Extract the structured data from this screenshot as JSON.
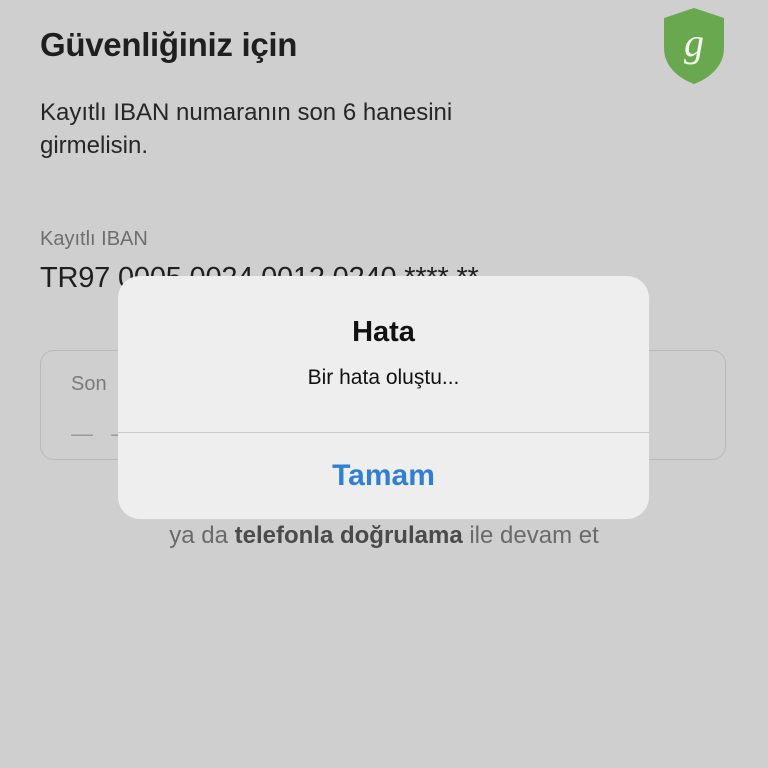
{
  "header": {
    "title": "Güvenliğiniz için",
    "logo_letter": "g",
    "logo_icon": "shield-logo-icon",
    "logo_color": "#6aa84f"
  },
  "content": {
    "description": "Kayıtlı IBAN numaranın son 6 hanesini girmelisin.",
    "iban_label": "Kayıtlı IBAN",
    "iban_value": "TR97 0005 0024 0012 0240 **** **",
    "input_label": "Son",
    "input_placeholder": "— —",
    "alt_prefix": "ya da ",
    "alt_bold": "telefonla doğrulama",
    "alt_suffix": " ile devam et"
  },
  "alert": {
    "title": "Hata",
    "message": "Bir hata oluştu...",
    "ok_label": "Tamam",
    "ok_color": "#2f7fd3"
  }
}
